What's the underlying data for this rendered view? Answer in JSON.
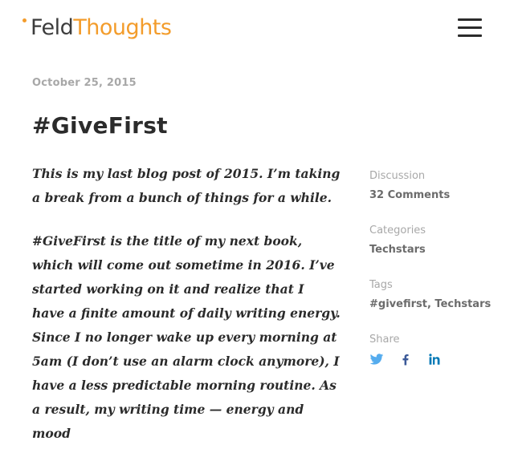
{
  "header": {
    "logo_part1": "Feld",
    "logo_part2": "Thoughts"
  },
  "post": {
    "date": "October 25, 2015",
    "title": "#GiveFirst",
    "paragraphs": [
      "This is my last blog post of 2015. I’m taking a break from a bunch of things for a while.",
      "#GiveFirst is the title of my next book, which will come out sometime in 2016. I’ve started working on it and realize that I have a finite amount of daily writing energy. Since I no longer wake up every morning at 5am (I don’t use an alarm clock anymore), I have a less predictable morning routine. As a result, my writing time — energy and mood"
    ]
  },
  "sidebar": {
    "discussion_label": "Discussion",
    "discussion_value": "32 Comments",
    "categories_label": "Categories",
    "categories_value": "Techstars",
    "tags_label": "Tags",
    "tags": [
      "#givefirst",
      "Techstars"
    ],
    "tags_separator": ", ",
    "share_label": "Share"
  },
  "colors": {
    "accent": "#f39c2b",
    "text": "#2b2b2b",
    "muted": "#a8a8a8",
    "twitter": "#55acee",
    "facebook": "#3b5998",
    "linkedin": "#0077b5"
  },
  "icons": {
    "menu": "hamburger-menu-icon",
    "twitter": "twitter-icon",
    "facebook": "facebook-icon",
    "linkedin": "linkedin-icon"
  }
}
